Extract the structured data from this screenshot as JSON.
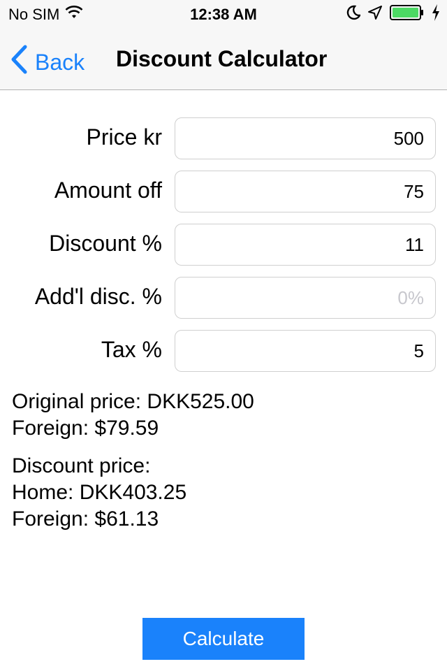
{
  "status_bar": {
    "carrier": "No SIM",
    "time": "12:38 AM",
    "icons": [
      "wifi-icon",
      "moon-icon",
      "location-arrow-icon",
      "battery-icon",
      "charging-bolt-icon"
    ],
    "battery_color": "#4cd964"
  },
  "nav": {
    "back_label": "Back",
    "title": "Discount Calculator",
    "accent_color": "#1a82fb"
  },
  "form": {
    "fields": [
      {
        "label": "Price kr",
        "value": "500",
        "placeholder": ""
      },
      {
        "label": "Amount off",
        "value": "75",
        "placeholder": ""
      },
      {
        "label": "Discount %",
        "value": "11",
        "placeholder": ""
      },
      {
        "label": "Add'l disc. %",
        "value": "",
        "placeholder": "0%"
      },
      {
        "label": "Tax %",
        "value": "5",
        "placeholder": ""
      }
    ]
  },
  "results": {
    "original_price": "Original price: DKK525.00",
    "original_foreign": "Foreign: $79.59",
    "discount_heading": "Discount price:",
    "discount_home": "Home: DKK403.25",
    "discount_foreign": "Foreign: $61.13"
  },
  "actions": {
    "calculate_label": "Calculate"
  }
}
